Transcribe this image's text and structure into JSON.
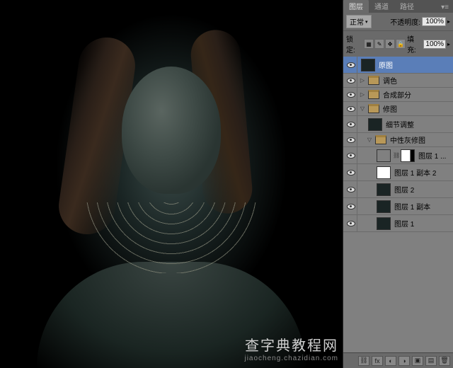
{
  "tabs": {
    "layers": "图层",
    "channels": "通道",
    "paths": "路径"
  },
  "options": {
    "blend_mode": "正常",
    "opacity_label": "不透明度:",
    "opacity_value": "100%",
    "lock_label": "锁定:",
    "fill_label": "填充:",
    "fill_value": "100%"
  },
  "layers": [
    {
      "name": "原图",
      "selected": true,
      "indent": 0,
      "thumb": "img"
    },
    {
      "name": "调色",
      "indent": 0,
      "type": "group",
      "open": false
    },
    {
      "name": "合成部分",
      "indent": 0,
      "type": "group",
      "open": false
    },
    {
      "name": "修图",
      "indent": 0,
      "type": "group",
      "open": true
    },
    {
      "name": "细节调整",
      "indent": 1,
      "thumb": "img"
    },
    {
      "name": "中性灰修图",
      "indent": 1,
      "type": "group",
      "open": true
    },
    {
      "name": "图层 1 ...",
      "indent": 2,
      "thumb": "gray",
      "mask": true,
      "linked": true
    },
    {
      "name": "图层 1 副本 2",
      "indent": 2,
      "thumb": "white"
    },
    {
      "name": "图层 2",
      "indent": 2,
      "thumb": "img"
    },
    {
      "name": "图层 1 副本",
      "indent": 2,
      "thumb": "img"
    },
    {
      "name": "图层 1",
      "indent": 2,
      "thumb": "img"
    }
  ],
  "watermark": {
    "main": "查字典教程网",
    "sub": "jiaocheng.chazidian.com"
  }
}
